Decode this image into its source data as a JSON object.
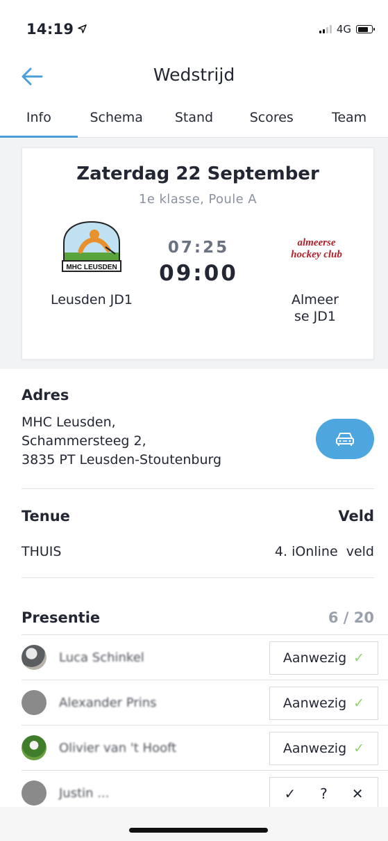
{
  "status": {
    "time": "14:19",
    "network": "4G"
  },
  "nav": {
    "title": "Wedstrijd"
  },
  "tabs": [
    {
      "label": "Info",
      "active": true
    },
    {
      "label": "Schema"
    },
    {
      "label": "Stand"
    },
    {
      "label": "Scores"
    },
    {
      "label": "Team"
    }
  ],
  "match": {
    "date": "Zaterdag 22 September",
    "league": "1e klasse, Poule A",
    "time_small": "07:25",
    "time_big": "09:00",
    "home": {
      "name": "Leusden JD1",
      "logo_text": "MHC LEUSDEN"
    },
    "away": {
      "name": "Almeerse JD1",
      "logo_text_1": "almeerse",
      "logo_text_2": "hockey club"
    }
  },
  "address": {
    "heading": "Adres",
    "line1": "MHC Leusden,",
    "line2": "Schammersteeg 2,",
    "line3": "3835 PT Leusden-Stoutenburg"
  },
  "tenue": {
    "heading": "Tenue",
    "value": "THUIS",
    "veld_heading": "Veld",
    "veld_value": "4. iOnline  veld"
  },
  "presentie": {
    "heading": "Presentie",
    "count": "6 / 20",
    "members": [
      {
        "name": "Luca Schinkel",
        "status": "Aanwezig"
      },
      {
        "name": "Alexander Prins",
        "status": "Aanwezig"
      },
      {
        "name": "Olivier van 't Hooft",
        "status": "Aanwezig"
      },
      {
        "name": "Justin ...",
        "status": ""
      }
    ]
  },
  "colors": {
    "accent": "#4a9fd9",
    "check": "#8fd16a"
  }
}
